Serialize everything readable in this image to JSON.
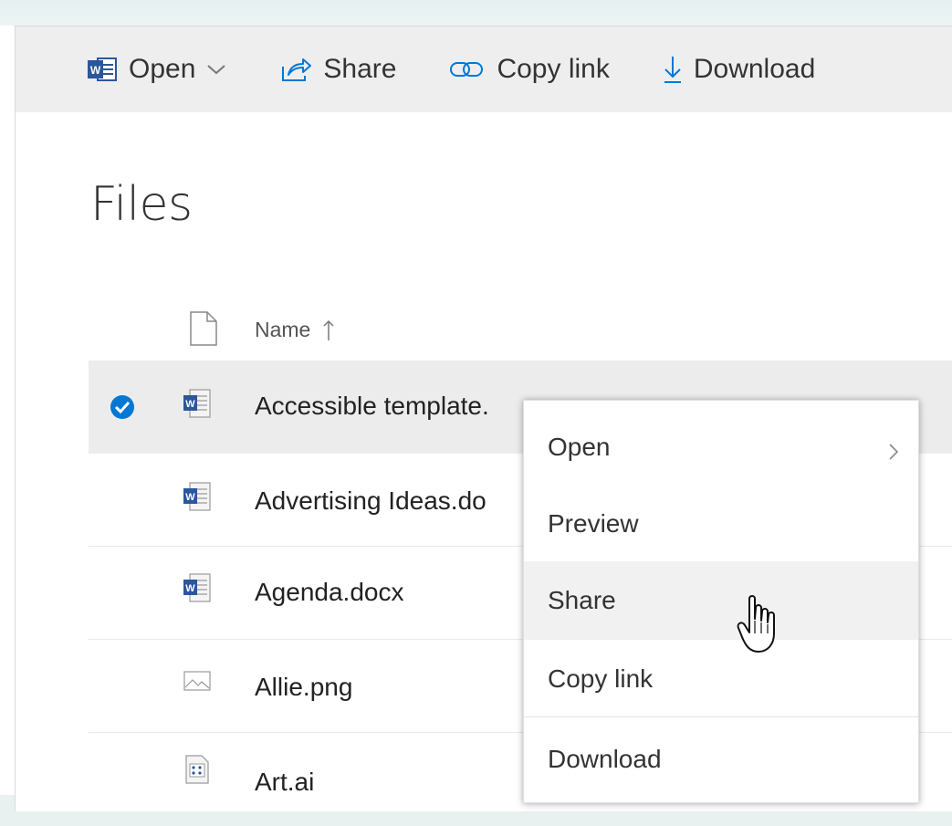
{
  "toolbar": {
    "open_label": "Open",
    "share_label": "Share",
    "copy_link_label": "Copy link",
    "download_label": "Download"
  },
  "page": {
    "title": "Files"
  },
  "list": {
    "column_name": "Name",
    "sort": "ascending",
    "files": [
      {
        "name": "Accessible template.",
        "type": "word",
        "selected": true
      },
      {
        "name": "Advertising Ideas.do",
        "type": "word",
        "selected": false
      },
      {
        "name": "Agenda.docx",
        "type": "word",
        "selected": false
      },
      {
        "name": "Allie.png",
        "type": "image",
        "selected": false
      },
      {
        "name": "Art.ai",
        "type": "illustrator",
        "selected": false
      }
    ]
  },
  "context_menu": {
    "items": [
      {
        "label": "Open",
        "has_submenu": true
      },
      {
        "label": "Preview",
        "has_submenu": false
      },
      {
        "label": "Share",
        "has_submenu": false,
        "hovered": true
      },
      {
        "label": "Copy link",
        "has_submenu": false
      },
      {
        "label": "Download",
        "has_submenu": false
      }
    ]
  },
  "colors": {
    "accent": "#0078d4",
    "word_blue": "#2b579a",
    "selected_row": "#ececec",
    "toolbar_bg": "#eeeeee"
  }
}
